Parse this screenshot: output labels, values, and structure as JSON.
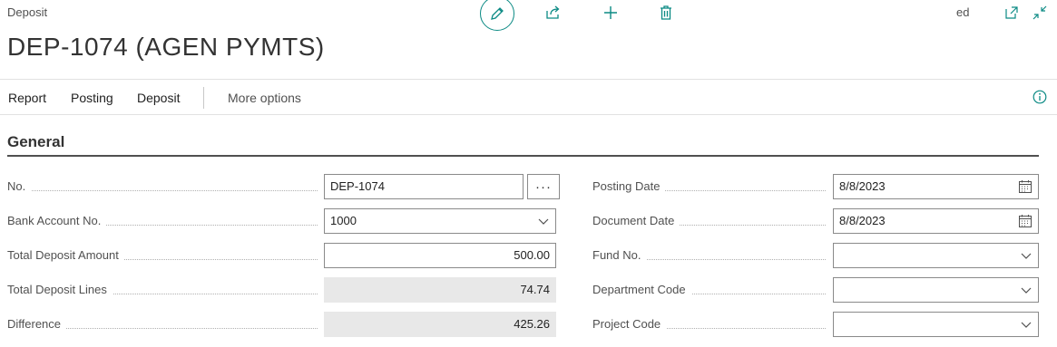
{
  "page": {
    "caption": "Deposit",
    "title": "DEP-1074 (AGEN PYMTS)",
    "saved_status": "ed"
  },
  "toolbar": {
    "icons": [
      "edit-icon",
      "share-icon",
      "new-icon",
      "delete-icon"
    ]
  },
  "actionbar": {
    "items": [
      "Report",
      "Posting",
      "Deposit"
    ],
    "more_label": "More options"
  },
  "section": {
    "title": "General"
  },
  "fields_left": {
    "no": {
      "label": "No.",
      "value": "DEP-1074"
    },
    "bank_account_no": {
      "label": "Bank Account No.",
      "value": "1000"
    },
    "total_deposit_amount": {
      "label": "Total Deposit Amount",
      "value": "500.00"
    },
    "total_deposit_lines": {
      "label": "Total Deposit Lines",
      "value": "74.74"
    },
    "difference": {
      "label": "Difference",
      "value": "425.26"
    }
  },
  "fields_right": {
    "posting_date": {
      "label": "Posting Date",
      "value": "8/8/2023"
    },
    "document_date": {
      "label": "Document Date",
      "value": "8/8/2023"
    },
    "fund_no": {
      "label": "Fund No.",
      "value": ""
    },
    "department_code": {
      "label": "Department Code",
      "value": ""
    },
    "project_code": {
      "label": "Project Code",
      "value": ""
    }
  },
  "colors": {
    "accent": "#0b8a84",
    "readonly_bg": "#e8e8e8"
  }
}
